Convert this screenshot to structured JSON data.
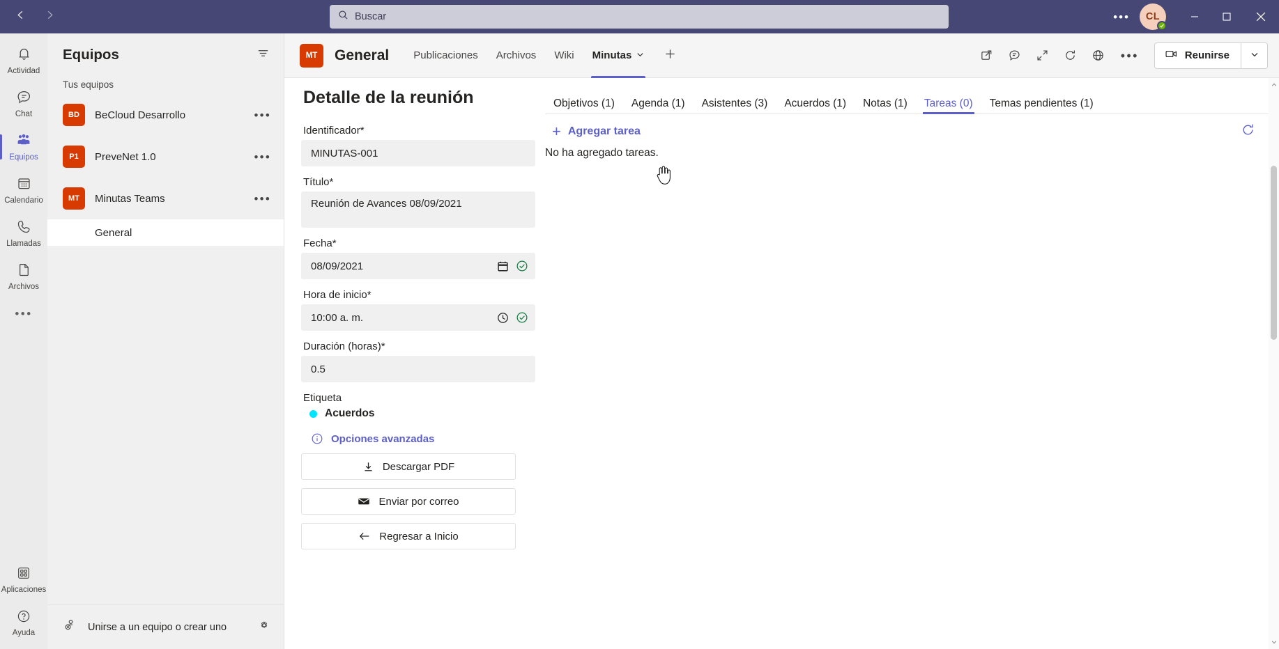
{
  "titlebar": {
    "back_icon": "chevron-left-icon",
    "forward_icon": "chevron-right-icon",
    "search_placeholder": "Buscar",
    "search_icon": "search-icon",
    "more_label": "•••",
    "avatar_initials": "CL",
    "presence": "available",
    "minimize": "—",
    "maximize": "□",
    "close": "✕"
  },
  "rail": {
    "items": [
      {
        "label": "Actividad",
        "icon": "bell-icon",
        "active": false
      },
      {
        "label": "Chat",
        "icon": "chat-icon",
        "active": false
      },
      {
        "label": "Equipos",
        "icon": "teams-icon",
        "active": true
      },
      {
        "label": "Calendario",
        "icon": "calendar-icon",
        "active": false
      },
      {
        "label": "Llamadas",
        "icon": "phone-icon",
        "active": false
      },
      {
        "label": "Archivos",
        "icon": "file-icon",
        "active": false
      }
    ],
    "more_label": "•••",
    "bottom_items": [
      {
        "label": "Aplicaciones",
        "icon": "apps-icon"
      },
      {
        "label": "Ayuda",
        "icon": "help-icon"
      }
    ]
  },
  "teams_panel": {
    "title": "Equipos",
    "filter_icon": "filter-icon",
    "section_label": "Tus equipos",
    "teams": [
      {
        "initials": "BD",
        "name": "BeCloud Desarrollo",
        "more": "•••"
      },
      {
        "initials": "P1",
        "name": "PreveNet 1.0",
        "more": "•••"
      },
      {
        "initials": "MT",
        "name": "Minutas Teams",
        "more": "•••"
      }
    ],
    "channel": {
      "name": "General",
      "active": true
    },
    "footer": {
      "label": "Unirse a un equipo o crear uno",
      "icon": "add-people-icon",
      "settings_icon": "gear-icon"
    }
  },
  "channel_header": {
    "team_initials": "MT",
    "title": "General",
    "tabs": [
      {
        "label": "Publicaciones",
        "active": false
      },
      {
        "label": "Archivos",
        "active": false
      },
      {
        "label": "Wiki",
        "active": false
      },
      {
        "label": "Minutas",
        "active": true,
        "chevron": true
      }
    ],
    "add_tab_icon": "plus-icon",
    "icons": [
      "open-in-new-icon",
      "conversation-icon",
      "expand-icon",
      "refresh-icon",
      "globe-icon"
    ],
    "more_label": "•••",
    "meet_button": {
      "label": "Reunirse",
      "icon": "video-camera-icon",
      "chevron": "chevron-down-icon"
    }
  },
  "form": {
    "page_title": "Detalle de la reunión",
    "fields": [
      {
        "label": "Identificador*",
        "value": "MINUTAS-001",
        "valid": false,
        "icon": null,
        "tall": false
      },
      {
        "label": "Título*",
        "value": "Reunión  de Avances 08/09/2021",
        "valid": false,
        "icon": null,
        "tall": true
      },
      {
        "label": "Fecha*",
        "value": "08/09/2021",
        "valid": true,
        "icon": "calendar-icon",
        "tall": false
      },
      {
        "label": "Hora de inicio*",
        "value": "10:00 a. m.",
        "valid": true,
        "icon": "clock-icon",
        "tall": false
      },
      {
        "label": "Duración (horas)*",
        "value": "0.5",
        "valid": false,
        "icon": null,
        "tall": false
      }
    ],
    "tag_label": "Etiqueta",
    "tag_name": "Acuerdos",
    "tag_color": "#00e5ff",
    "advanced_label": "Opciones avanzadas",
    "advanced_icon": "info-icon",
    "buttons": [
      {
        "label": "Descargar PDF",
        "icon": "download-icon"
      },
      {
        "label": "Enviar por correo",
        "icon": "mail-icon"
      },
      {
        "label": "Regresar a Inicio",
        "icon": "arrow-left-icon"
      }
    ]
  },
  "tasks_panel": {
    "tabs": [
      {
        "label": "Objetivos (1)",
        "active": false
      },
      {
        "label": "Agenda (1)",
        "active": false
      },
      {
        "label": "Asistentes (3)",
        "active": false
      },
      {
        "label": "Acuerdos (1)",
        "active": false
      },
      {
        "label": "Notas (1)",
        "active": false
      },
      {
        "label": "Tareas (0)",
        "active": true
      },
      {
        "label": "Temas pendientes (1)",
        "active": false
      }
    ],
    "add_label": "Agregar tarea",
    "add_icon": "plus-icon",
    "empty_message": "No ha agregado tareas.",
    "refresh_icon": "refresh-icon"
  },
  "colors": {
    "titlebar": "#464775",
    "accent": "#5b5fc7",
    "team_avatar": "#d83b01",
    "valid_check": "#107c41",
    "tag": "#00e5ff"
  }
}
